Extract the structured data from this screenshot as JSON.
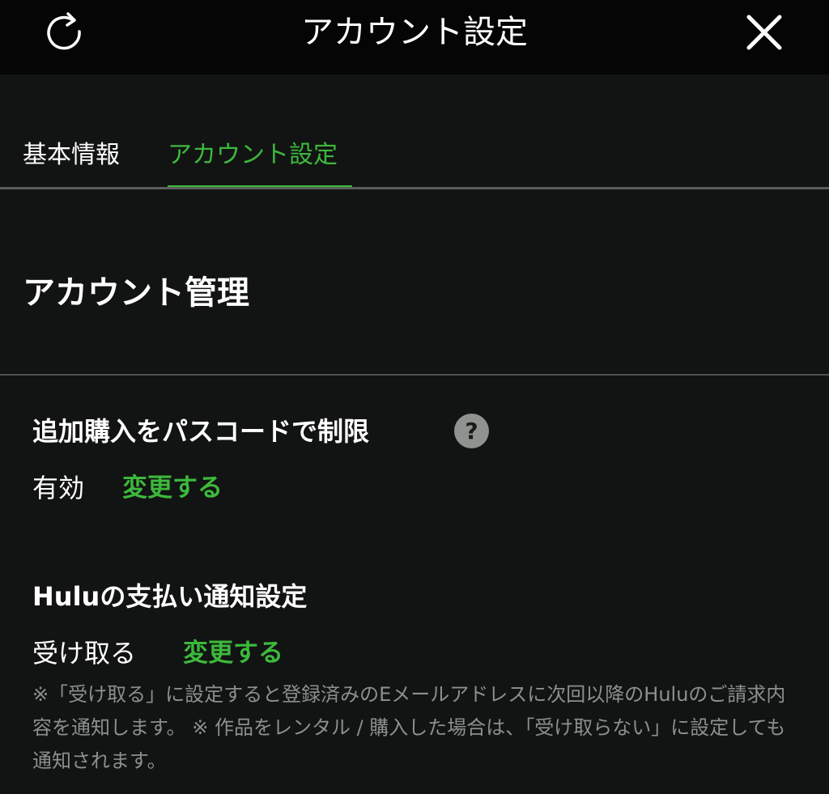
{
  "header": {
    "title": "アカウント設定",
    "refresh_icon": "refresh-icon",
    "close_icon": "close-icon"
  },
  "tabs": [
    {
      "label": "基本情報",
      "active": false
    },
    {
      "label": "アカウント設定",
      "active": true
    }
  ],
  "section": {
    "title": "アカウント管理"
  },
  "settings": [
    {
      "label": "追加購入をパスコードで制限",
      "help_glyph": "?",
      "value": "有効",
      "action": "変更する"
    },
    {
      "label": "Huluの支払い通知設定",
      "value": "受け取る",
      "action": "変更する",
      "note": "※「受け取る」に設定すると登録済みのEメールアドレスに次回以降のHuluのご請求内容を通知します。 ※ 作品をレンタル / 購入した場合は、「受け取らない」に設定しても通知されます。"
    }
  ],
  "colors": {
    "accent": "#3cb93c",
    "background": "#121313",
    "header_background": "#050505",
    "muted_text": "#8d8f8f"
  }
}
